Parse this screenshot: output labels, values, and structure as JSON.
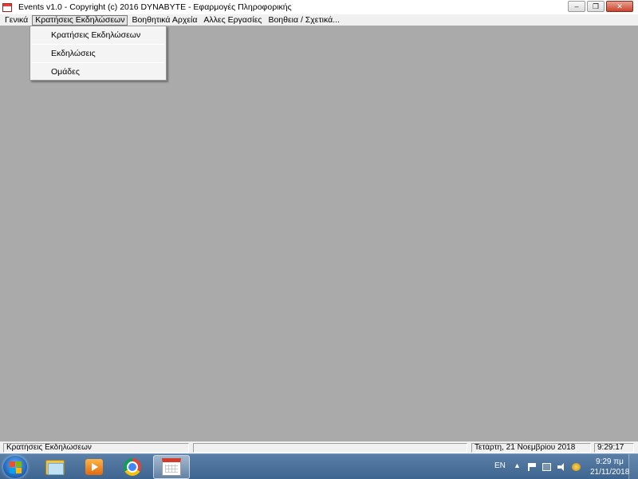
{
  "window": {
    "title": "Events  v1.0  -  Copyright (c) 2016  DYNABYTE - Εφαρμογές Πληροφορικής",
    "minimize_glyph": "–",
    "restore_glyph": "❐",
    "close_glyph": "✕"
  },
  "menu": {
    "items": [
      {
        "label": "Γενικά"
      },
      {
        "label": "Κρατήσεις Εκδηλώσεων",
        "active": true
      },
      {
        "label": "Βοηθητικά Αρχεία"
      },
      {
        "label": "Αλλες Εργασίες"
      },
      {
        "label": "Βοηθεια / Σχετικά..."
      }
    ]
  },
  "dropdown": {
    "items": [
      {
        "label": "Κρατήσεις Εκδηλώσεων"
      },
      {
        "label": "Εκδηλώσεις"
      },
      {
        "label": "Ομάδες"
      }
    ]
  },
  "statusbar": {
    "left": "Κρατήσεις Εκδηλώσεων",
    "middle": "",
    "date": "Τετάρτη, 21 Νοεμβρίου 2018",
    "time": "9:29:17"
  },
  "taskbar": {
    "apps": [
      "windows-explorer-icon",
      "media-player-icon",
      "chrome-icon",
      "calendar-app-icon"
    ],
    "tray": {
      "language": "EN",
      "clock_time": "9:29 πμ",
      "clock_date": "21/11/2018"
    }
  }
}
